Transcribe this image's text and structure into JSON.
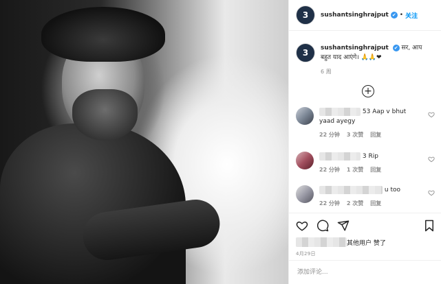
{
  "post": {
    "author": "sushantsinghrajput",
    "author_initial": "3",
    "verified_glyph": "✔",
    "dot": "•",
    "follow_label": "关注"
  },
  "caption": {
    "username": "sushantsinghrajput",
    "text": "सर, आप बहुत याद आएंगे। 🙏🙏❤",
    "time": "6 周"
  },
  "load_more": {
    "icon": "plus-circle-icon",
    "glyph": "+"
  },
  "comments": [
    {
      "text_suffix": "53 Aap v bhut yaad ayegy",
      "time": "22 分钟",
      "likes": "3 次赞",
      "reply": "回复"
    },
    {
      "text_suffix": "3 Rip",
      "time": "22 分钟",
      "likes": "1 次赞",
      "reply": "回复"
    },
    {
      "text_suffix": "u too",
      "time": "22 分钟",
      "likes": "2 次赞",
      "reply": "回复"
    }
  ],
  "likes": {
    "text": "其他用户 赞了"
  },
  "date": "4月29日",
  "add_comment": {
    "placeholder": "添加评论..."
  },
  "colors": {
    "link": "#0095f6",
    "verified": "#3897f0",
    "heart": "#ed4956",
    "muted": "#8e8e8e"
  }
}
